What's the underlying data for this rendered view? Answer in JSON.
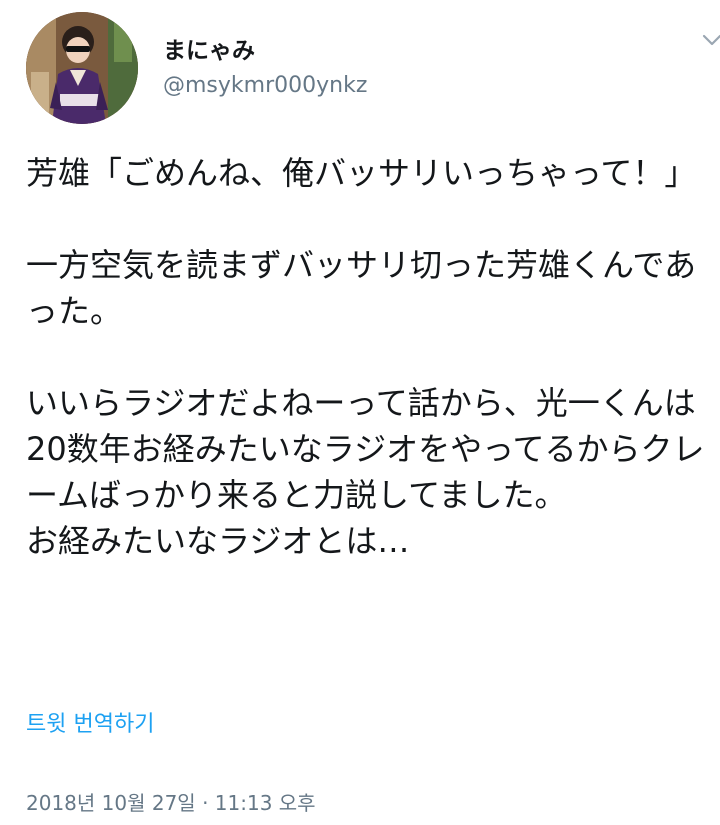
{
  "user": {
    "display_name": "まにゃみ",
    "handle": "@msykmr000ynkz"
  },
  "tweet": {
    "text": "芳雄「ごめんね、俺バッサリいっちゃって！」\n\n一方空気を読まずバッサリ切った芳雄くんであった。\n\nいいらラジオだよねーって話から、光一くんは20数年お経みたいなラジオをやってるからクレームばっかり来ると力説してました。\nお経みたいなラジオとは…",
    "translate_label": "트윗 번역하기",
    "timestamp": "2018년 10월 27일 · 11:13 오후"
  },
  "icons": {
    "avatar": "profile-photo",
    "caret": "chevron-down-icon"
  },
  "colors": {
    "text": "#14171a",
    "secondary": "#657786",
    "link": "#1da1f2"
  }
}
